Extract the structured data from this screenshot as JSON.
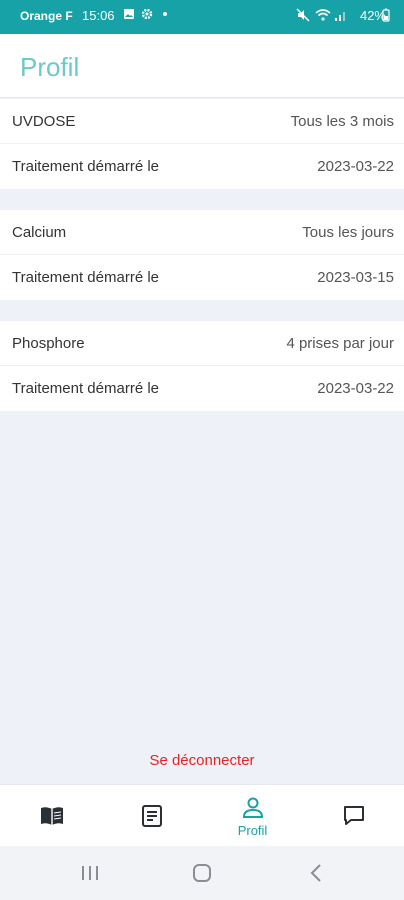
{
  "status_bar": {
    "carrier": "Orange F",
    "time": "15:06",
    "battery": "42%",
    "background_color": "#17a2a8"
  },
  "header": {
    "title": "Profil",
    "title_color": "#6cc9c4"
  },
  "treatments": [
    {
      "name": "UVDOSE",
      "frequency": "Tous les 3 mois",
      "start_label": "Traitement démarré le",
      "start_date": "2023-03-22"
    },
    {
      "name": "Calcium",
      "frequency": "Tous les jours",
      "start_label": "Traitement démarré le",
      "start_date": "2023-03-15"
    },
    {
      "name": "Phosphore",
      "frequency": "4 prises par jour",
      "start_label": "Traitement démarré le",
      "start_date": "2023-03-22"
    }
  ],
  "logout": {
    "label": "Se déconnecter",
    "color": "#e8231f"
  },
  "bottom_nav": {
    "items": [
      {
        "icon": "book-icon",
        "label": ""
      },
      {
        "icon": "document-icon",
        "label": ""
      },
      {
        "icon": "profile-icon",
        "label": "Profil",
        "active": true
      },
      {
        "icon": "chat-icon",
        "label": ""
      }
    ],
    "active_color": "#17a2a8"
  },
  "system_nav": {
    "buttons": [
      "recents-icon",
      "home-icon",
      "back-icon"
    ]
  }
}
